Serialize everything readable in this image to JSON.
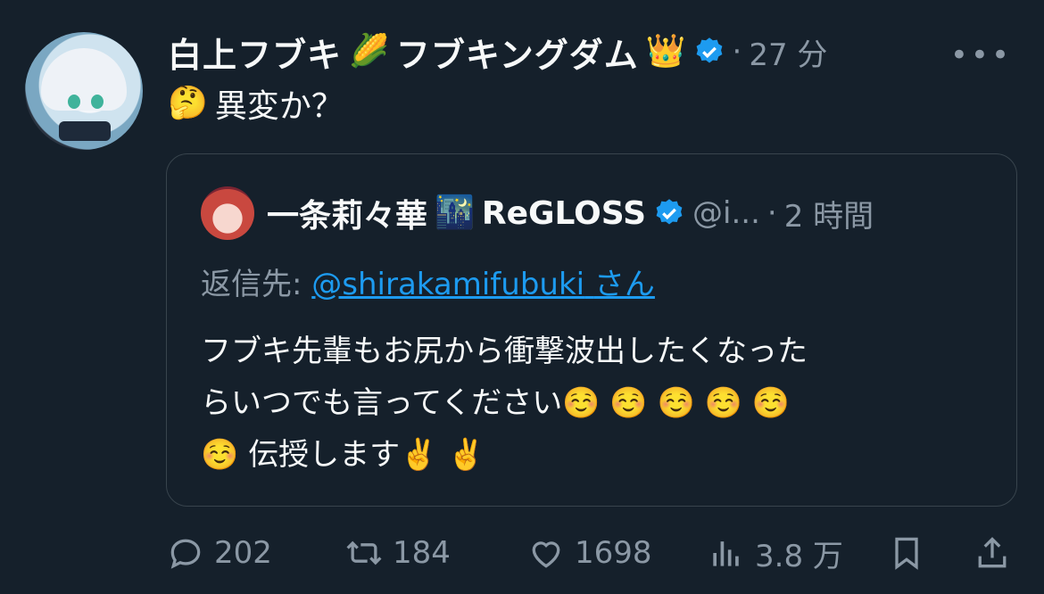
{
  "tweet": {
    "author_name": "白上フブキ",
    "name_emoji_1": "🌽",
    "name_suffix": "フブキングダム",
    "name_emoji_2": "👑",
    "separator": "·",
    "time": "27 分",
    "more": "•••",
    "text_emoji": "🤔",
    "text": "異変か？"
  },
  "quote": {
    "author_name": "一条莉々華",
    "name_emoji": "🌃",
    "name_suffix": "ReGLOSS",
    "handle": "@i...",
    "separator": "·",
    "time": "2 時間",
    "reply_label": "返信先:",
    "reply_mention": "@shirakamifubuki",
    "reply_suffix": "さん",
    "body_lines": [
      "フブキ先輩もお尻から衝撃波出したくなった",
      "らいつでも言ってください☺️ ☺️ ☺️ ☺️ ☺️",
      "☺️ 伝授します✌️ ✌️"
    ]
  },
  "actions": {
    "replies": "202",
    "retweets": "184",
    "likes": "1698",
    "views": "3.8 万"
  },
  "colors": {
    "background": "#15202b",
    "text": "#f7f9f9",
    "muted": "#8b98a5",
    "accent": "#1d9bf0",
    "border": "#38444d"
  }
}
